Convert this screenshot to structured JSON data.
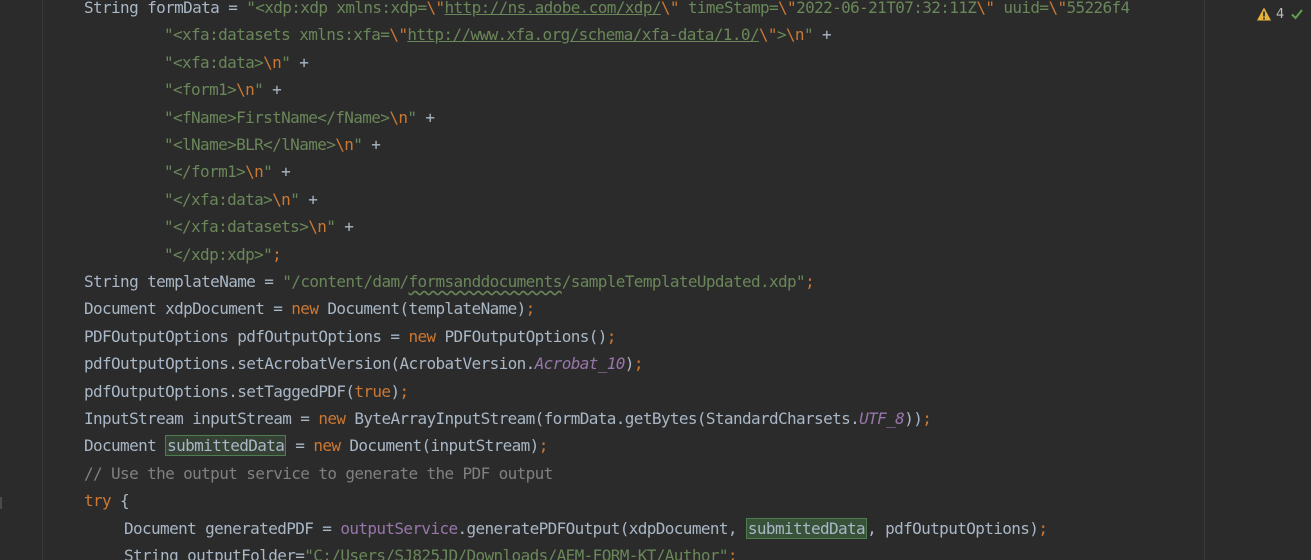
{
  "code_lines": [
    {
      "indent": 0,
      "tokens": [
        {
          "t": "String formData = ",
          "c": "plain"
        },
        {
          "t": "\"<xdp:xdp xmlns:xdp=",
          "c": "str"
        },
        {
          "t": "\\\"",
          "c": "esc"
        },
        {
          "t": "http://ns.adobe.com/xdp/",
          "c": "link"
        },
        {
          "t": "\\\"",
          "c": "esc"
        },
        {
          "t": " timeStamp=",
          "c": "str"
        },
        {
          "t": "\\\"",
          "c": "esc"
        },
        {
          "t": "2022-06-21T07:32:11Z",
          "c": "str"
        },
        {
          "t": "\\\"",
          "c": "esc"
        },
        {
          "t": " uuid=",
          "c": "str"
        },
        {
          "t": "\\\"",
          "c": "esc"
        },
        {
          "t": "55226f4",
          "c": "str"
        }
      ]
    },
    {
      "indent": 2,
      "tokens": [
        {
          "t": "\"<xfa:datasets xmlns:xfa=",
          "c": "str"
        },
        {
          "t": "\\\"",
          "c": "esc"
        },
        {
          "t": "http://www.xfa.org/schema/xfa-data/1.0/",
          "c": "link"
        },
        {
          "t": "\\\"",
          "c": "esc"
        },
        {
          "t": ">",
          "c": "str"
        },
        {
          "t": "\\n",
          "c": "esc"
        },
        {
          "t": "\"",
          "c": "str"
        },
        {
          "t": " +",
          "c": "plain"
        }
      ]
    },
    {
      "indent": 2,
      "tokens": [
        {
          "t": "\"<xfa:data>",
          "c": "str"
        },
        {
          "t": "\\n",
          "c": "esc"
        },
        {
          "t": "\"",
          "c": "str"
        },
        {
          "t": " +",
          "c": "plain"
        }
      ]
    },
    {
      "indent": 2,
      "tokens": [
        {
          "t": "\"<form1>",
          "c": "str"
        },
        {
          "t": "\\n",
          "c": "esc"
        },
        {
          "t": "\"",
          "c": "str"
        },
        {
          "t": " +",
          "c": "plain"
        }
      ]
    },
    {
      "indent": 2,
      "tokens": [
        {
          "t": "\"<fName>FirstName</fName>",
          "c": "str"
        },
        {
          "t": "\\n",
          "c": "esc"
        },
        {
          "t": "\"",
          "c": "str"
        },
        {
          "t": " +",
          "c": "plain"
        }
      ]
    },
    {
      "indent": 2,
      "tokens": [
        {
          "t": "\"<lName>BLR</lName>",
          "c": "str"
        },
        {
          "t": "\\n",
          "c": "esc"
        },
        {
          "t": "\"",
          "c": "str"
        },
        {
          "t": " +",
          "c": "plain"
        }
      ]
    },
    {
      "indent": 2,
      "tokens": [
        {
          "t": "\"</form1>",
          "c": "str"
        },
        {
          "t": "\\n",
          "c": "esc"
        },
        {
          "t": "\"",
          "c": "str"
        },
        {
          "t": " +",
          "c": "plain"
        }
      ]
    },
    {
      "indent": 2,
      "tokens": [
        {
          "t": "\"</xfa:data>",
          "c": "str"
        },
        {
          "t": "\\n",
          "c": "esc"
        },
        {
          "t": "\"",
          "c": "str"
        },
        {
          "t": " +",
          "c": "plain"
        }
      ]
    },
    {
      "indent": 2,
      "tokens": [
        {
          "t": "\"</xfa:datasets>",
          "c": "str"
        },
        {
          "t": "\\n",
          "c": "esc"
        },
        {
          "t": "\"",
          "c": "str"
        },
        {
          "t": " +",
          "c": "plain"
        }
      ]
    },
    {
      "indent": 2,
      "tokens": [
        {
          "t": "\"</xdp:xdp>\"",
          "c": "str"
        },
        {
          "t": ";",
          "c": "semi"
        }
      ]
    },
    {
      "indent": 0,
      "tokens": [
        {
          "t": "String templateName = ",
          "c": "plain"
        },
        {
          "t": "\"/content/dam/",
          "c": "str"
        },
        {
          "t": "formsanddocuments",
          "c": "str wavy"
        },
        {
          "t": "/sampleTemplateUpdated.xdp\"",
          "c": "str"
        },
        {
          "t": ";",
          "c": "semi"
        }
      ]
    },
    {
      "indent": 0,
      "tokens": [
        {
          "t": "Document xdpDocument = ",
          "c": "plain"
        },
        {
          "t": "new",
          "c": "kw"
        },
        {
          "t": " Document(templateName)",
          "c": "plain"
        },
        {
          "t": ";",
          "c": "semi"
        }
      ]
    },
    {
      "indent": 0,
      "tokens": [
        {
          "t": "PDFOutputOptions pdfOutputOptions = ",
          "c": "plain"
        },
        {
          "t": "new",
          "c": "kw"
        },
        {
          "t": " PDFOutputOptions()",
          "c": "plain"
        },
        {
          "t": ";",
          "c": "semi"
        }
      ]
    },
    {
      "indent": 0,
      "tokens": [
        {
          "t": "pdfOutputOptions.setAcrobatVersion(AcrobatVersion.",
          "c": "plain"
        },
        {
          "t": "Acrobat_10",
          "c": "italic-const"
        },
        {
          "t": ")",
          "c": "plain"
        },
        {
          "t": ";",
          "c": "semi"
        }
      ]
    },
    {
      "indent": 0,
      "tokens": [
        {
          "t": "pdfOutputOptions.setTaggedPDF(",
          "c": "plain"
        },
        {
          "t": "true",
          "c": "kw"
        },
        {
          "t": ")",
          "c": "plain"
        },
        {
          "t": ";",
          "c": "semi"
        }
      ]
    },
    {
      "indent": 0,
      "tokens": [
        {
          "t": "InputStream inputStream = ",
          "c": "plain"
        },
        {
          "t": "new",
          "c": "kw"
        },
        {
          "t": " ByteArrayInputStream(formData.getBytes(StandardCharsets.",
          "c": "plain"
        },
        {
          "t": "UTF_8",
          "c": "italic-const"
        },
        {
          "t": "))",
          "c": "plain"
        },
        {
          "t": ";",
          "c": "semi"
        }
      ]
    },
    {
      "indent": 0,
      "tokens": [
        {
          "t": "Document ",
          "c": "plain"
        },
        {
          "t": "submittedData",
          "c": "plain hl"
        },
        {
          "t": " = ",
          "c": "plain"
        },
        {
          "t": "new",
          "c": "kw"
        },
        {
          "t": " Document(inputStream)",
          "c": "plain"
        },
        {
          "t": ";",
          "c": "semi"
        }
      ]
    },
    {
      "indent": 0,
      "tokens": [
        {
          "t": "// Use the output service to generate the PDF output",
          "c": "comment"
        }
      ]
    },
    {
      "indent": 0,
      "tokens": [
        {
          "t": "try",
          "c": "kw"
        },
        {
          "t": " {",
          "c": "plain"
        }
      ]
    },
    {
      "indent": 1,
      "tokens": [
        {
          "t": "Document generatedPDF = ",
          "c": "plain"
        },
        {
          "t": "outputService",
          "c": "field"
        },
        {
          "t": ".generatePDFOutput(xdpDocument, ",
          "c": "plain"
        },
        {
          "t": "submittedData",
          "c": "plain hl-solid"
        },
        {
          "t": ", pdfOutputOptions)",
          "c": "plain"
        },
        {
          "t": ";",
          "c": "semi"
        }
      ]
    },
    {
      "indent": 1,
      "tokens": [
        {
          "t": "String outputFolder=",
          "c": "plain"
        },
        {
          "t": "\"C:/Users/SJ825JD/Downloads/AEM-FORM-KT/Author\"",
          "c": "str"
        },
        {
          "t": ";",
          "c": "semi"
        }
      ]
    }
  ],
  "inspection": {
    "warning_count": "4",
    "warning_color": "#e8b339",
    "ok_color": "#5fa14f"
  }
}
